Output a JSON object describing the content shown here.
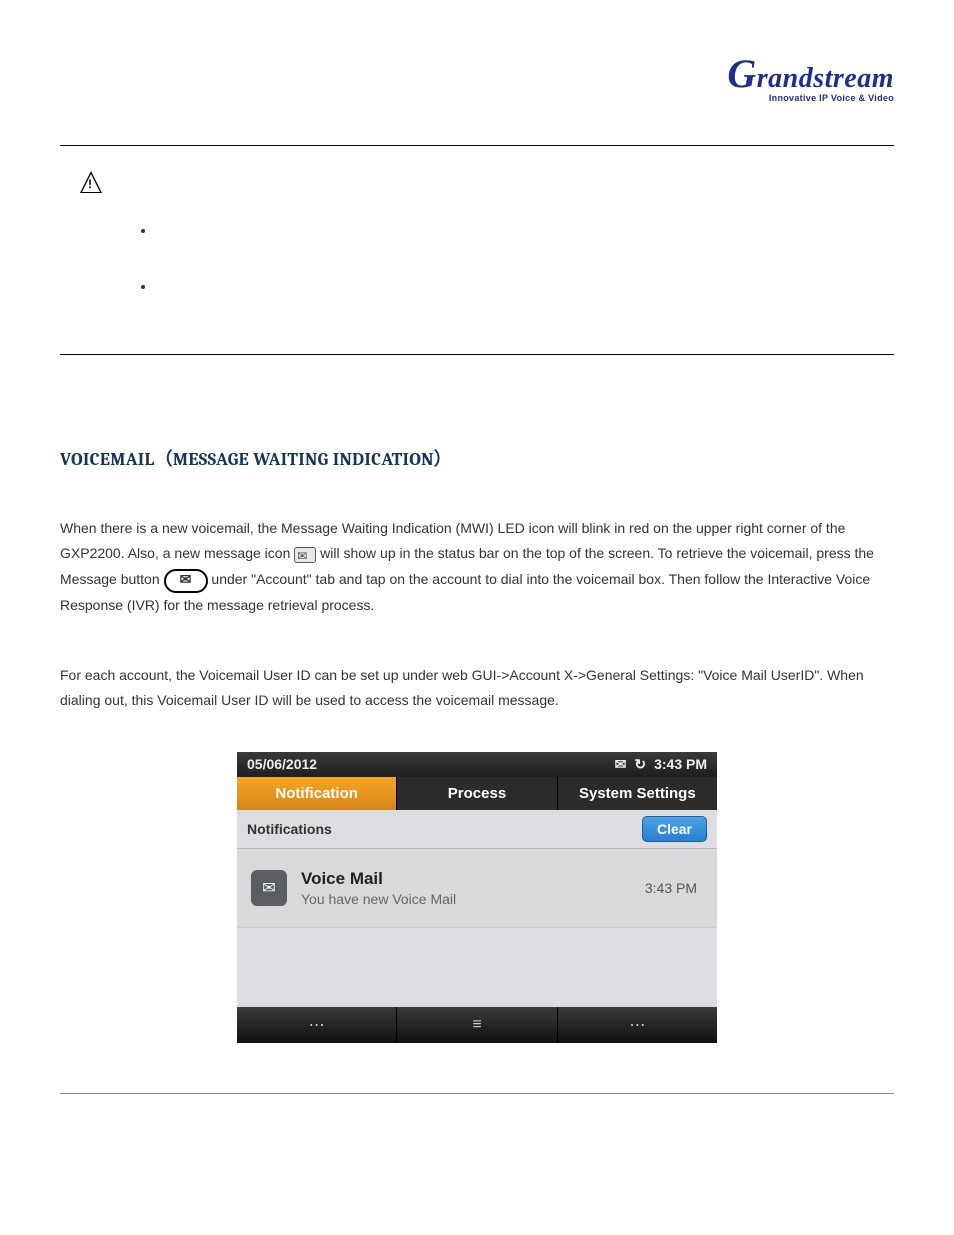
{
  "brand": {
    "name": "Grandstream",
    "tagline": "Innovative IP Voice & Video"
  },
  "section": {
    "title": "VOICEMAIL（MESSAGE WAITING INDICATION）"
  },
  "paragraph": {
    "p1a": "When there is a new voicemail, the Message Waiting Indication (MWI) LED icon will blink in red on the upper right corner of the GXP2200. Also, a new message icon ",
    "p1b": " will show up in the status bar on the top of the screen. To retrieve the voicemail, press the Message button ",
    "p1c": " under \"Account\" tab and tap on the account to dial into the voicemail box. Then follow the Interactive Voice Response (IVR) for the message retrieval process.",
    "p2": "For each account, the Voicemail User ID can be set up under web GUI->Account X->General Settings: \"Voice Mail UserID\". When dialing out, this Voicemail User ID will be used to access the voicemail message."
  },
  "device": {
    "status": {
      "date": "05/06/2012",
      "time": "3:43 PM"
    },
    "tabs": {
      "notification": "Notification",
      "process": "Process",
      "settings": "System Settings"
    },
    "subheader": {
      "label": "Notifications",
      "clear": "Clear"
    },
    "notif": {
      "title": "Voice Mail",
      "subtitle": "You have new Voice Mail",
      "time": "3:43 PM"
    }
  }
}
